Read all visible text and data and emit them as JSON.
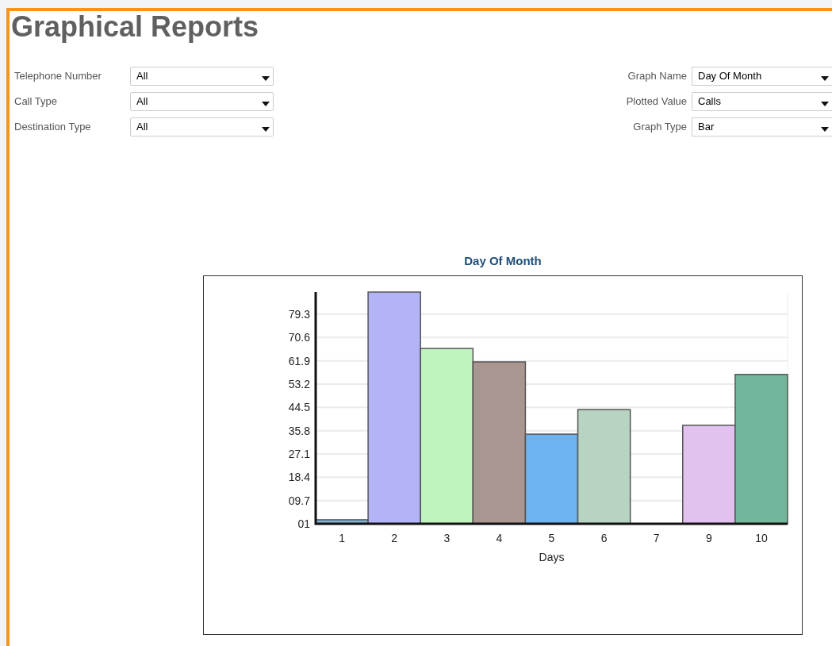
{
  "title": "Graphical Reports",
  "filters_left": [
    {
      "label": "Telephone Number",
      "value": "All"
    },
    {
      "label": "Call Type",
      "value": "All"
    },
    {
      "label": "Destination Type",
      "value": "All"
    }
  ],
  "filters_right": [
    {
      "label": "Graph Name",
      "value": "Day Of Month"
    },
    {
      "label": "Plotted Value",
      "value": "Calls"
    },
    {
      "label": "Graph Type",
      "value": "Bar"
    }
  ],
  "chart": {
    "chart_data": {
      "type": "bar",
      "title": "Day Of Month",
      "xlabel": "Days",
      "categories": [
        "1",
        "2",
        "3",
        "4",
        "5",
        "6",
        "7",
        "9",
        "10"
      ],
      "grid": true,
      "series": [
        {
          "colors": [
            "#7fb1d1",
            "#b3b3f7",
            "#c0f4be",
            "#aa9690",
            "#6db3f0",
            "#b7d3c1",
            null,
            "#e2c1ef",
            "#73b69b"
          ],
          "values": [
            2.5,
            87.6,
            66.5,
            61.5,
            34.5,
            43.7,
            null,
            37.8,
            56.8
          ]
        }
      ],
      "ylim": [
        1,
        87.6
      ],
      "yticks": [
        {
          "value": 1,
          "label": "01"
        },
        {
          "value": 9.7,
          "label": "09.7"
        },
        18.4,
        27.1,
        35.8,
        44.5,
        53.2,
        61.9,
        70.6,
        79.3
      ]
    }
  }
}
